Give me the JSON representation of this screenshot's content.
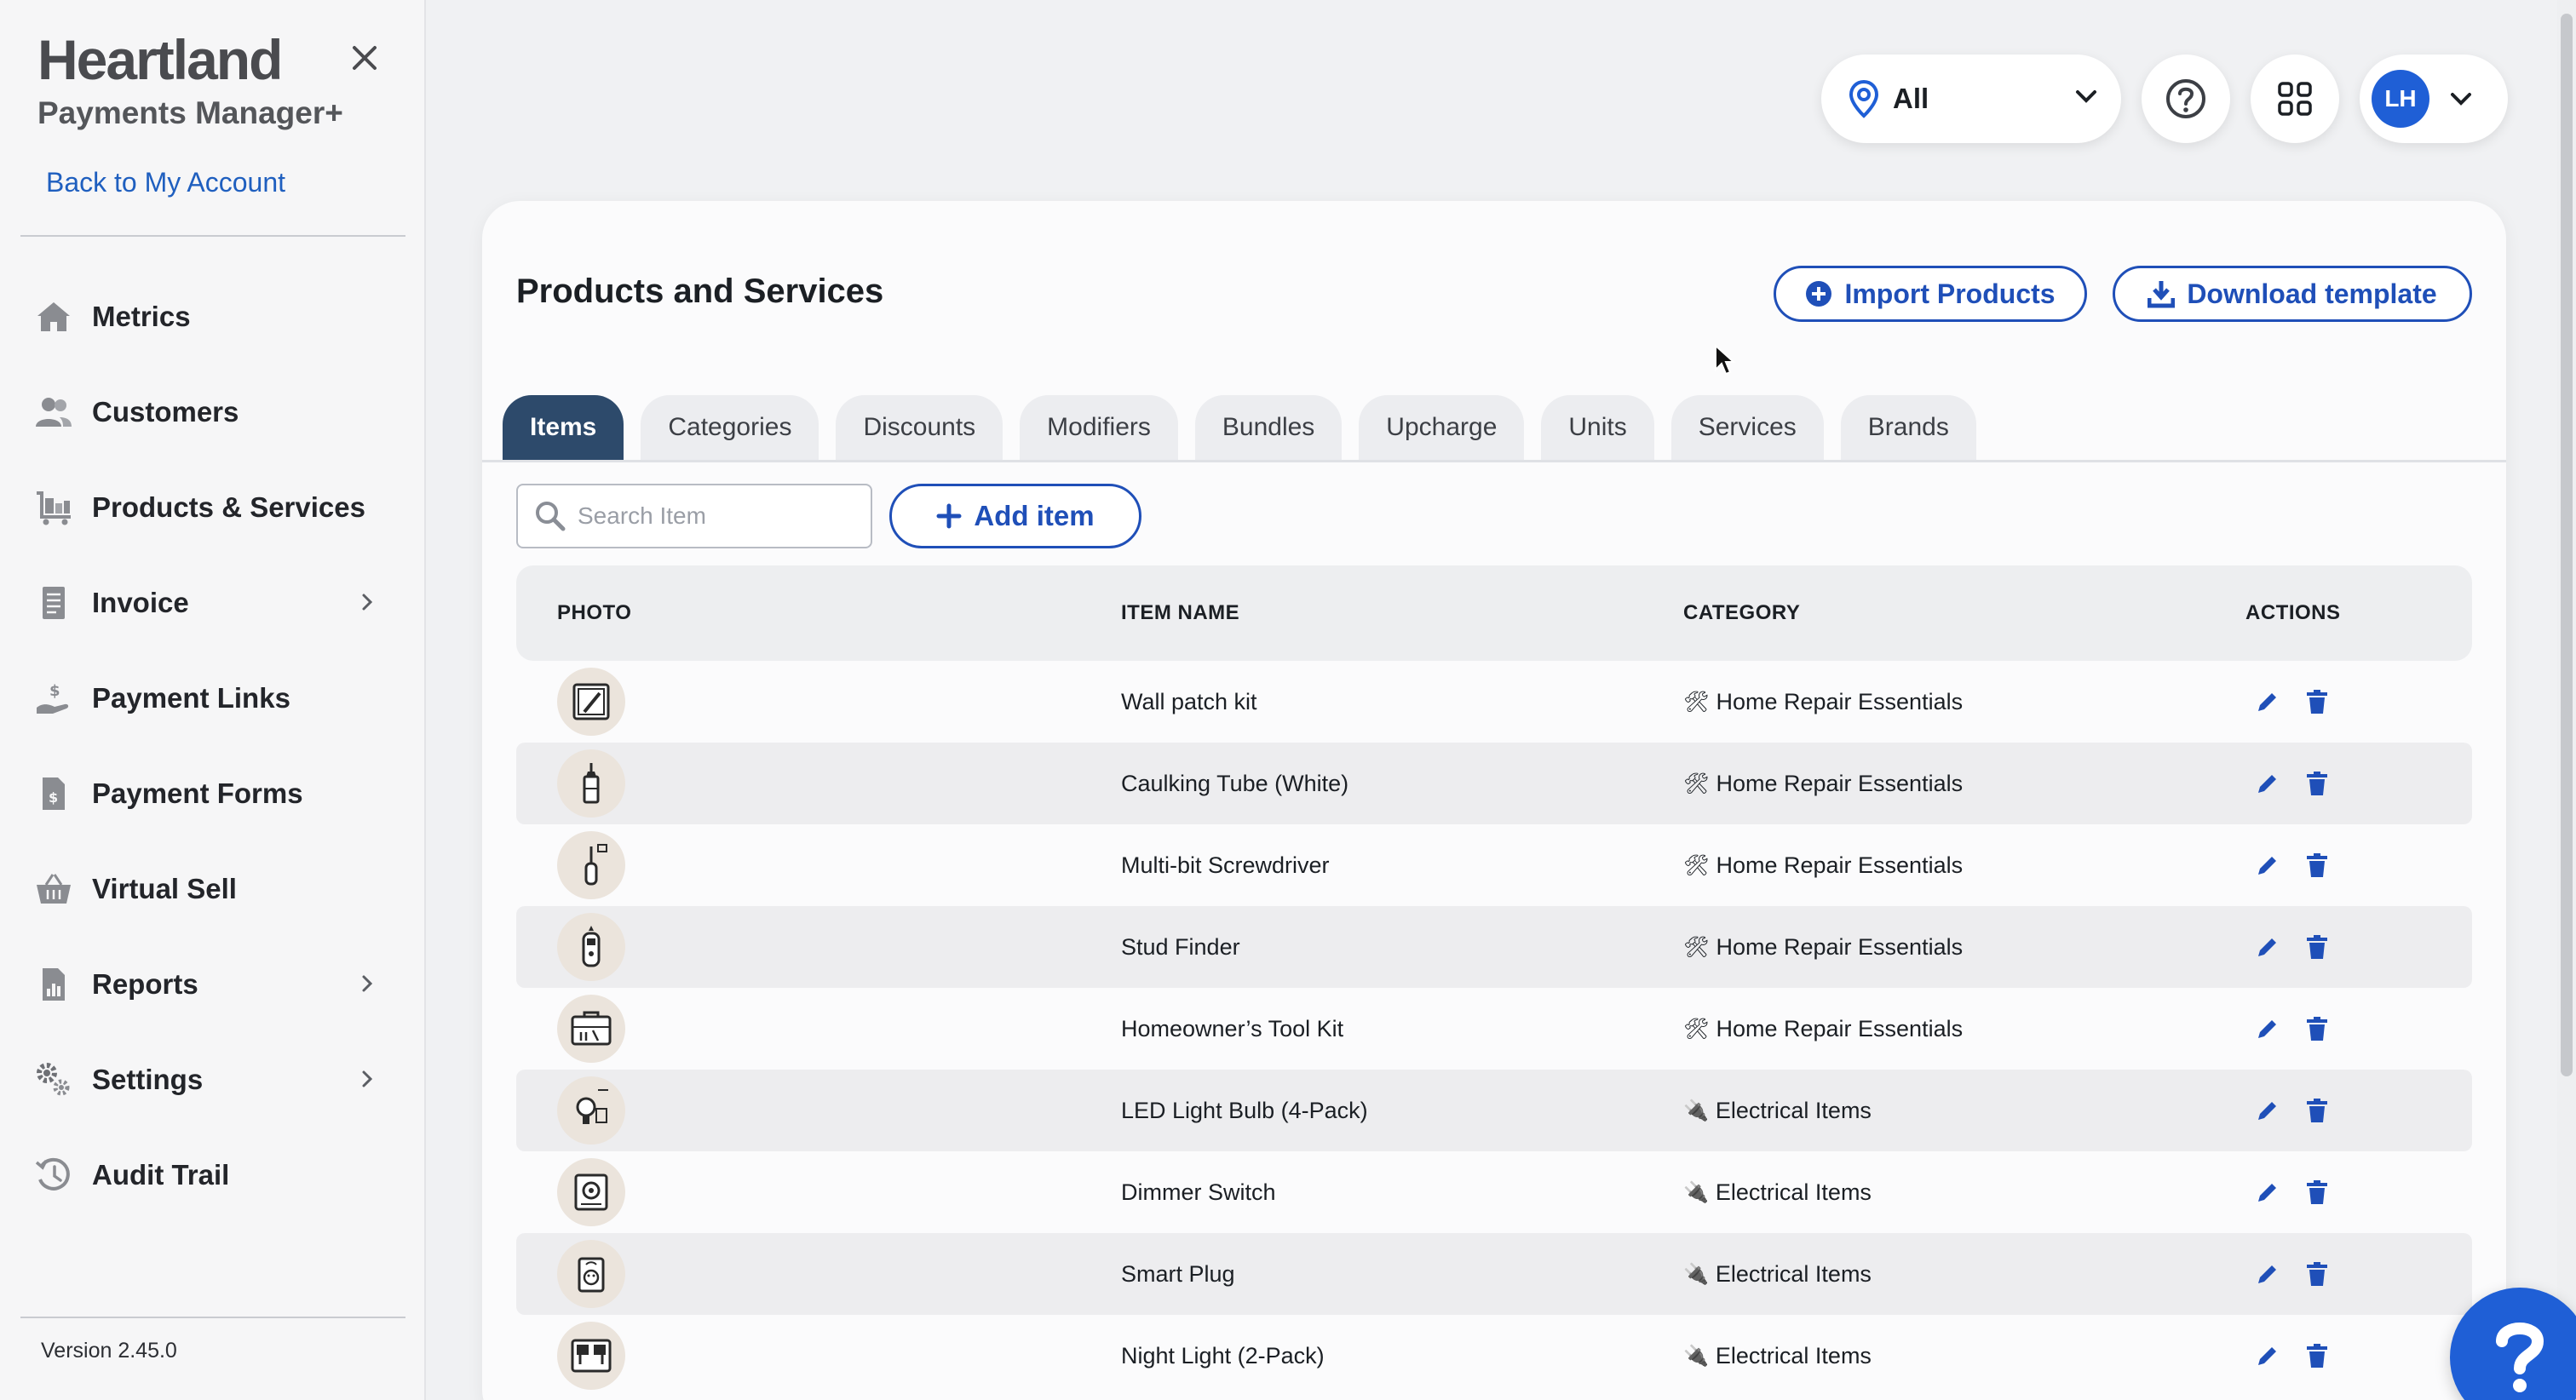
{
  "sidebar": {
    "brand_name": "Heartland",
    "brand_sub": "Payments Manager+",
    "back_link": "Back to My Account",
    "items": [
      {
        "label": "Metrics",
        "icon": "home-icon",
        "chevron": false
      },
      {
        "label": "Customers",
        "icon": "users-icon",
        "chevron": false
      },
      {
        "label": "Products & Services",
        "icon": "cart-icon",
        "chevron": false
      },
      {
        "label": "Invoice",
        "icon": "invoice-icon",
        "chevron": true
      },
      {
        "label": "Payment Links",
        "icon": "payment-link-icon",
        "chevron": false
      },
      {
        "label": "Payment Forms",
        "icon": "payment-form-icon",
        "chevron": false
      },
      {
        "label": "Virtual Sell",
        "icon": "basket-icon",
        "chevron": false
      },
      {
        "label": "Reports",
        "icon": "report-icon",
        "chevron": true
      },
      {
        "label": "Settings",
        "icon": "gears-icon",
        "chevron": true
      },
      {
        "label": "Audit Trail",
        "icon": "history-icon",
        "chevron": false
      }
    ],
    "version": "Version 2.45.0"
  },
  "topbar": {
    "location_label": "All",
    "avatar_initials": "LH"
  },
  "page": {
    "title": "Products and Services",
    "import_label": "Import Products",
    "download_label": "Download template",
    "tabs": [
      "Items",
      "Categories",
      "Discounts",
      "Modifiers",
      "Bundles",
      "Upcharge",
      "Units",
      "Services",
      "Brands"
    ],
    "active_tab": "Items",
    "search_placeholder": "Search Item",
    "add_label": "Add item"
  },
  "table": {
    "headers": {
      "photo": "PHOTO",
      "name": "ITEM NAME",
      "category": "CATEGORY",
      "actions": "ACTIONS"
    },
    "rows": [
      {
        "name": "Wall patch kit",
        "category": "Home Repair Essentials",
        "cat_emoji": "🛠",
        "icon": "patch-kit-icon"
      },
      {
        "name": "Caulking Tube (White)",
        "category": "Home Repair Essentials",
        "cat_emoji": "🛠",
        "icon": "caulk-tube-icon"
      },
      {
        "name": "Multi-bit Screwdriver",
        "category": "Home Repair Essentials",
        "cat_emoji": "🛠",
        "icon": "screwdriver-icon"
      },
      {
        "name": "Stud Finder",
        "category": "Home Repair Essentials",
        "cat_emoji": "🛠",
        "icon": "stud-finder-icon"
      },
      {
        "name": "Homeowner’s Tool Kit",
        "category": "Home Repair Essentials",
        "cat_emoji": "🛠",
        "icon": "toolbox-icon"
      },
      {
        "name": "LED Light Bulb (4-Pack)",
        "category": "Electrical Items",
        "cat_emoji": "🔌",
        "icon": "bulb-icon"
      },
      {
        "name": "Dimmer Switch",
        "category": "Electrical Items",
        "cat_emoji": "🔌",
        "icon": "dimmer-icon"
      },
      {
        "name": "Smart Plug",
        "category": "Electrical Items",
        "cat_emoji": "🔌",
        "icon": "plug-icon"
      },
      {
        "name": "Night Light (2-Pack)",
        "category": "Electrical Items",
        "cat_emoji": "🔌",
        "icon": "night-light-icon"
      }
    ]
  },
  "colors": {
    "accent": "#1f4fb8",
    "active_tab": "#2d4a6b",
    "avatar": "#1f5fd6",
    "photo_bg": "#ebe4dc"
  }
}
